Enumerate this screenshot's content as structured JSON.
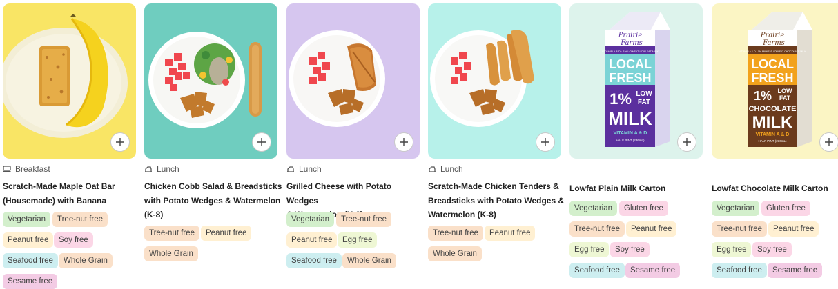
{
  "colors": {
    "tile_yellow": "#f9e565",
    "tile_teal": "#6fcdbf",
    "tile_lavender": "#d6c6ef",
    "tile_aqua": "#b7f1ea",
    "tile_mint": "#ddf3ec",
    "tile_cream": "#fbf5c4"
  },
  "icons": {
    "add": "plus-icon",
    "breakfast": "toast-icon",
    "lunch": "tray-icon"
  },
  "cards": [
    {
      "meal": "Breakfast",
      "title_lines": [
        "Scratch-Made Maple Oat Bar",
        "(Housemade) with Banana"
      ],
      "tags": [
        "Vegetarian",
        "Tree-nut free",
        "Peanut free",
        "Soy free",
        "Seafood free",
        "Whole Grain",
        "Sesame free"
      ]
    },
    {
      "meal": "Lunch",
      "title_lines": [
        "Chicken Cobb Salad & Breadsticks",
        "with Potato Wedges & Watermelon",
        "(K-8)"
      ],
      "tags": [
        "Tree-nut free",
        "Peanut free",
        "Whole Grain"
      ]
    },
    {
      "meal": "Lunch",
      "title_lines": [
        "Grilled Cheese with Potato Wedges",
        "& Watermelon (K-8)"
      ],
      "tags": [
        "Vegetarian",
        "Tree-nut free",
        "Peanut free",
        "Egg free",
        "Seafood free",
        "Whole Grain"
      ]
    },
    {
      "meal": "Lunch",
      "title_lines": [
        "Scratch-Made Chicken Tenders &",
        "Breadsticks with Potato Wedges &",
        "Watermelon (K-8)"
      ],
      "tags": [
        "Tree-nut free",
        "Peanut free",
        "Whole Grain"
      ]
    },
    {
      "meal": "",
      "title_lines": [
        "Lowfat Plain Milk Carton"
      ],
      "tags": [
        "Vegetarian",
        "Gluten free",
        "Tree-nut free",
        "Peanut free",
        "Egg free",
        "Soy free",
        "Seafood free",
        "Sesame free"
      ],
      "carton": {
        "brand_top": "Prairie",
        "brand_bottom": "Farms",
        "tagline": "VITAMIN A & D · 1% LOWFAT LOW FAT MILK",
        "local": "LOCAL",
        "fresh": "FRESH",
        "pct": "1%",
        "kind_top": "LOW",
        "kind_bottom": "FAT",
        "product": "MILK",
        "vitamin": "VITAMIN A & D",
        "size": "HALF PINT (236mL)"
      }
    },
    {
      "meal": "",
      "title_lines": [
        "Lowfat Chocolate Milk Carton"
      ],
      "tags": [
        "Vegetarian",
        "Gluten free",
        "Tree-nut free",
        "Peanut free",
        "Egg free",
        "Soy free",
        "Seafood free",
        "Sesame free"
      ],
      "carton": {
        "brand_top": "Prairie",
        "brand_bottom": "Farms",
        "tagline": "VITAMIN A & D · 1% MILKFAT LOW FAT CHOCOLATE MILK",
        "local": "LOCAL",
        "fresh": "FRESH",
        "pct": "1%",
        "kind_top": "LOW",
        "kind_bottom": "FAT",
        "product_top": "CHOCOLATE",
        "product": "MILK",
        "vitamin": "VITAMIN A & D",
        "size": "HALF PINT (236mL)"
      }
    }
  ]
}
